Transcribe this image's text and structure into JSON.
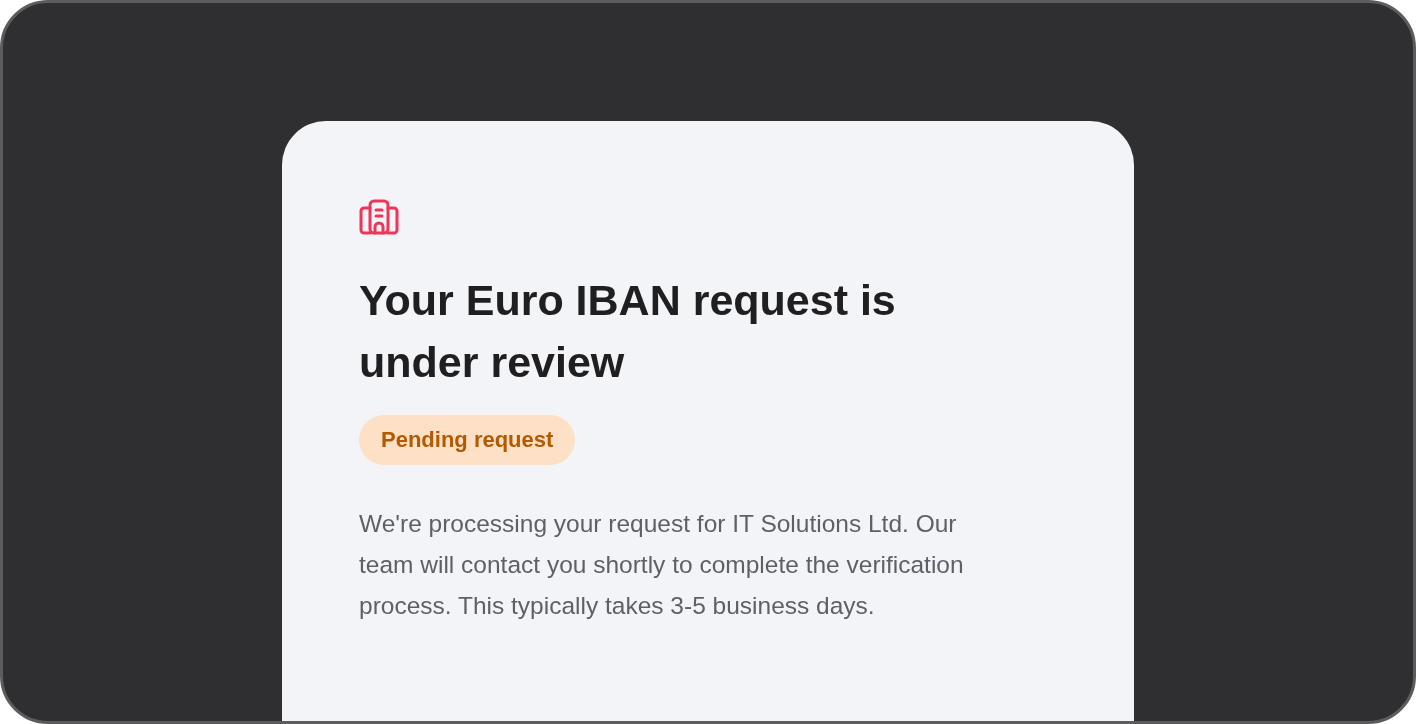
{
  "card": {
    "title": "Your Euro IBAN request is under review",
    "status_badge": "Pending request",
    "description": "We're processing your request for IT Solutions Ltd. Our team will contact you shortly to complete the verification process. This typically takes 3-5 business days."
  }
}
